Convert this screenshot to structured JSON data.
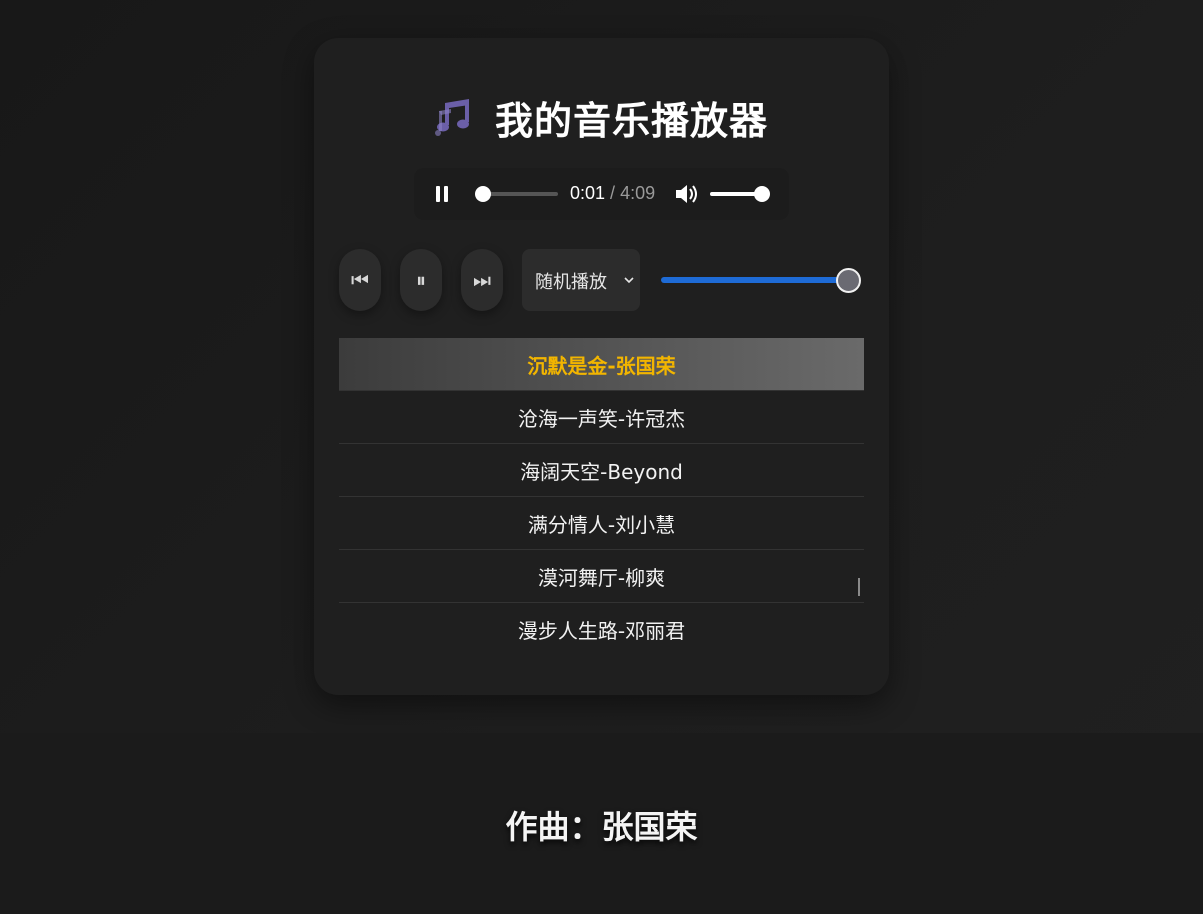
{
  "header": {
    "title": "我的音乐播放器",
    "icon": "music-notes-icon",
    "icon_color": "#6b5fa8"
  },
  "audio": {
    "current_time": "0:01",
    "separator": " / ",
    "duration": "4:09",
    "progress": 0.004,
    "volume": 1.0
  },
  "controls": {
    "prev_icon": "⏮",
    "pause_icon": "⏸",
    "next_icon": "⏭",
    "mode_selected": "随机播放",
    "slider_value": 1.0,
    "slider_color": "#1e6bd6"
  },
  "playlist": [
    {
      "title": "沉默是金-张国荣",
      "active": true
    },
    {
      "title": "沧海一声笑-许冠杰",
      "active": false
    },
    {
      "title": "海阔天空-Beyond",
      "active": false
    },
    {
      "title": "满分情人-刘小慧",
      "active": false
    },
    {
      "title": "漠河舞厅-柳爽",
      "active": false
    },
    {
      "title": "漫步人生路-邓丽君",
      "active": false
    }
  ],
  "footer": {
    "composer": "作曲：张国荣"
  },
  "colors": {
    "active_song": "#f2b500",
    "card_bg": "#1f1f1f"
  }
}
